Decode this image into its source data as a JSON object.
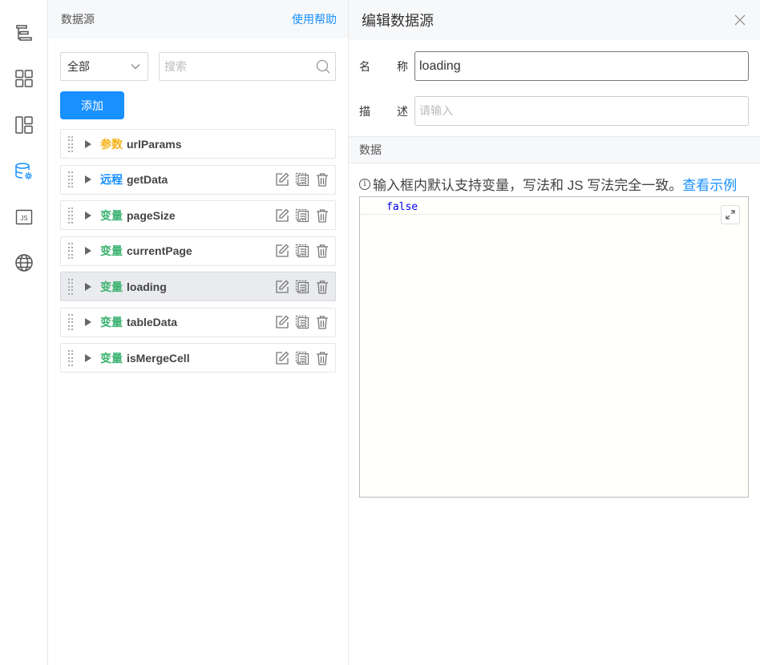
{
  "rail": {
    "items": [
      {
        "icon": "outline-tree-icon"
      },
      {
        "icon": "components-grid-icon"
      },
      {
        "icon": "layout-icon"
      },
      {
        "icon": "datasource-settings-icon",
        "active": true
      },
      {
        "icon": "js-file-icon"
      },
      {
        "icon": "globe-icon"
      }
    ]
  },
  "datasource_panel": {
    "title": "数据源",
    "help_link": "使用帮助",
    "filter_select": "全部",
    "search_placeholder": "搜索",
    "add_button": "添加",
    "items": [
      {
        "type": "参数",
        "type_color": "#f5b21a",
        "name": "urlParams",
        "has_actions": false
      },
      {
        "type": "远程",
        "type_color": "#1890ff",
        "name": "getData",
        "has_actions": true
      },
      {
        "type": "变量",
        "type_color": "#3cb371",
        "name": "pageSize",
        "has_actions": true
      },
      {
        "type": "变量",
        "type_color": "#3cb371",
        "name": "currentPage",
        "has_actions": true
      },
      {
        "type": "变量",
        "type_color": "#3cb371",
        "name": "loading",
        "has_actions": true,
        "active": true
      },
      {
        "type": "变量",
        "type_color": "#3cb371",
        "name": "tableData",
        "has_actions": true
      },
      {
        "type": "变量",
        "type_color": "#3cb371",
        "name": "isMergeCell",
        "has_actions": true
      }
    ]
  },
  "editor": {
    "title": "编辑数据源",
    "name_label_1": "名",
    "name_label_2": "称",
    "name_value": "loading",
    "desc_label_1": "描",
    "desc_label_2": "述",
    "desc_placeholder": "请输入",
    "data_section": "数据",
    "hint_text": "输入框内默认支持变量，写法和 JS 写法完全一致。",
    "hint_link": "查看示例",
    "code_value": "false"
  }
}
